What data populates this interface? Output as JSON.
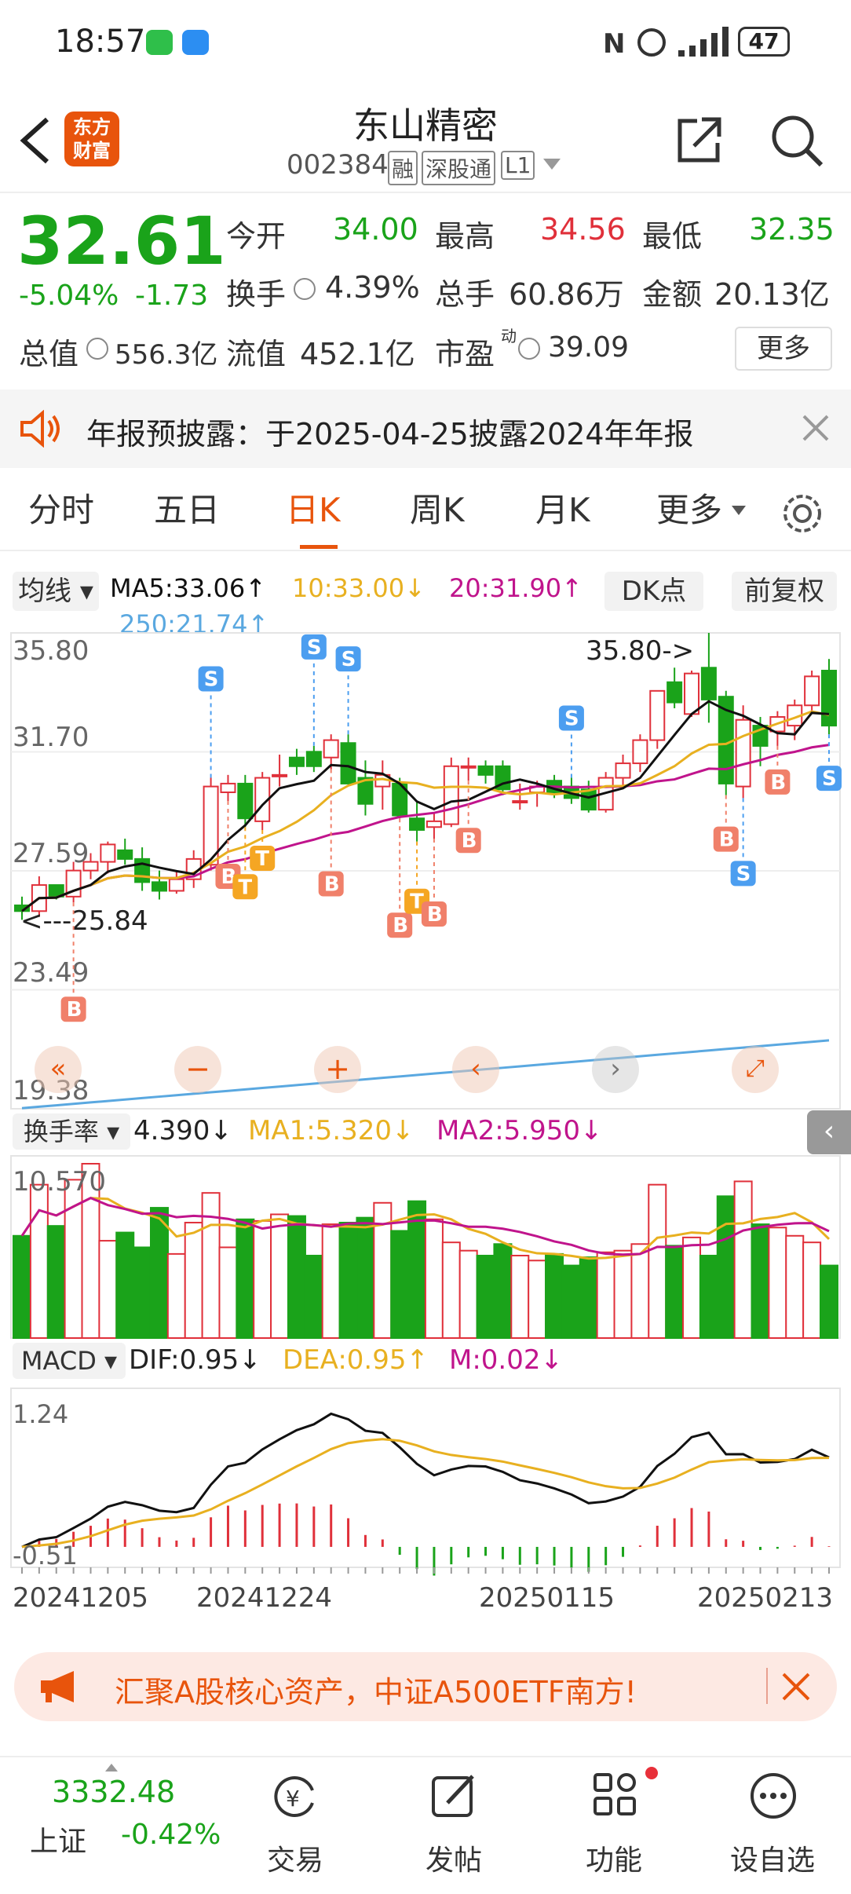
{
  "status": {
    "time": "18:57",
    "battery": "47"
  },
  "header": {
    "logo": "东方\n财富",
    "title": "东山精密",
    "code": "002384",
    "tags": [
      "融",
      "深股通",
      "L1"
    ]
  },
  "quote": {
    "price": "32.61",
    "pct": "-5.04%",
    "chg": "-1.73",
    "open_l": "今开",
    "open": "34.00",
    "high_l": "最高",
    "high": "34.56",
    "low_l": "最低",
    "low": "32.35",
    "turn_l": "换手",
    "turn": "4.39%",
    "vol_l": "总手",
    "vol": "60.86万",
    "amt_l": "金额",
    "amt": "20.13亿",
    "mcap_l": "总值",
    "mcap": "556.3亿",
    "fcap_l": "流值",
    "fcap": "452.1亿",
    "pe_l": "市盈",
    "pe_sup": "动",
    "pe": "39.09",
    "more": "更多"
  },
  "notice": {
    "text": "年报预披露：于2025-04-25披露2024年年报"
  },
  "tabs": [
    {
      "label": "分时"
    },
    {
      "label": "五日"
    },
    {
      "label": "日K"
    },
    {
      "label": "周K"
    },
    {
      "label": "月K"
    },
    {
      "label": "更多"
    }
  ],
  "ma": {
    "selector": "均线",
    "ma5": "MA5:33.06↑",
    "ma10": "10:33.00↓",
    "ma20": "20:31.90↑",
    "ma250": "250:21.74↑",
    "dk": "DK点",
    "fq": "前复权"
  },
  "kchart": {
    "y_labels": [
      "35.80",
      "31.70",
      "27.59",
      "23.49",
      "19.38"
    ],
    "max_label": "35.80->",
    "min_label": "<---25.84"
  },
  "turnover": {
    "selector": "换手率",
    "value": "4.390↓",
    "ma1": "MA1:5.320↓",
    "ma2": "MA2:5.950↓",
    "y_label": "10.570"
  },
  "macd": {
    "selector": "MACD",
    "dif": "DIF:0.95↓",
    "dea": "DEA:0.95↑",
    "m": "M:0.02↓",
    "y_top": "1.24",
    "y_bot": "-0.51"
  },
  "dates": [
    "20241205",
    "20241224",
    "20250115",
    "20250213"
  ],
  "banner": {
    "text": "汇聚A股核心资产，中证A500ETF南方!"
  },
  "bottom": {
    "index_val": "3332.48",
    "index_name": "上证",
    "index_pct": "-0.42%",
    "items": [
      {
        "label": "交易"
      },
      {
        "label": "发帖"
      },
      {
        "label": "功能"
      },
      {
        "label": "设自选"
      }
    ]
  },
  "colors": {
    "up": "#e0303a",
    "down": "#1aa31a",
    "ma5": "#111111",
    "ma10": "#e8b020",
    "ma20": "#c0148c",
    "ma250": "#5aa8e0",
    "accent": "#e8540c"
  },
  "chart_data": {
    "type": "candlestick",
    "candles": [
      [
        26.4,
        26.7,
        25.9,
        26.2
      ],
      [
        26.2,
        27.4,
        26.0,
        27.1
      ],
      [
        27.1,
        27.0,
        26.6,
        26.7
      ],
      [
        26.7,
        27.9,
        26.5,
        27.6
      ],
      [
        27.6,
        28.2,
        27.3,
        27.9
      ],
      [
        27.9,
        28.6,
        27.5,
        28.5
      ],
      [
        28.3,
        28.7,
        27.8,
        28.0
      ],
      [
        28.0,
        28.4,
        26.9,
        27.2
      ],
      [
        27.2,
        27.6,
        26.6,
        26.9
      ],
      [
        26.9,
        27.6,
        26.8,
        27.3
      ],
      [
        27.3,
        28.3,
        27.0,
        28.0
      ],
      [
        27.8,
        30.8,
        27.6,
        30.5
      ],
      [
        30.3,
        30.9,
        30.0,
        30.6
      ],
      [
        30.6,
        30.9,
        29.1,
        29.4
      ],
      [
        29.3,
        31.0,
        29.0,
        30.8
      ],
      [
        30.9,
        31.6,
        30.5,
        30.9
      ],
      [
        31.5,
        31.8,
        30.9,
        31.2
      ],
      [
        31.7,
        31.9,
        31.0,
        31.2
      ],
      [
        31.5,
        32.3,
        31.1,
        32.1
      ],
      [
        32.0,
        32.3,
        30.6,
        30.6
      ],
      [
        30.8,
        31.4,
        29.5,
        29.9
      ],
      [
        30.5,
        31.4,
        29.7,
        30.9
      ],
      [
        30.6,
        30.8,
        29.4,
        29.5
      ],
      [
        29.4,
        30.0,
        28.6,
        29.0
      ],
      [
        29.1,
        29.6,
        28.7,
        29.3
      ],
      [
        29.2,
        31.5,
        29.1,
        31.2
      ],
      [
        31.2,
        31.5,
        30.7,
        31.2
      ],
      [
        31.2,
        31.4,
        30.6,
        30.9
      ],
      [
        31.2,
        31.4,
        30.2,
        30.4
      ],
      [
        30.0,
        30.6,
        29.7,
        30.0
      ],
      [
        30.3,
        30.7,
        29.8,
        30.5
      ],
      [
        30.7,
        30.9,
        30.1,
        30.3
      ],
      [
        30.5,
        30.8,
        29.9,
        30.1
      ],
      [
        30.4,
        30.7,
        29.6,
        29.7
      ],
      [
        29.7,
        31.0,
        29.6,
        30.8
      ],
      [
        30.8,
        31.6,
        30.5,
        31.3
      ],
      [
        31.3,
        32.3,
        31.0,
        32.1
      ],
      [
        32.1,
        33.8,
        31.8,
        33.8
      ],
      [
        34.1,
        34.6,
        33.2,
        33.4
      ],
      [
        33.0,
        34.5,
        32.9,
        34.4
      ],
      [
        34.6,
        35.8,
        32.7,
        33.5
      ],
      [
        33.6,
        33.8,
        30.2,
        30.6
      ],
      [
        30.5,
        33.3,
        30.1,
        32.8
      ],
      [
        32.6,
        32.9,
        31.2,
        31.9
      ],
      [
        32.4,
        33.1,
        31.9,
        32.9
      ],
      [
        32.6,
        33.5,
        32.1,
        33.3
      ],
      [
        33.3,
        34.5,
        33.0,
        34.3
      ],
      [
        34.5,
        34.9,
        32.3,
        32.6
      ]
    ],
    "ylim": [
      19.38,
      35.8
    ],
    "max_label": "35.80",
    "min_label": "25.84",
    "turnover_ylim": [
      0,
      10.57
    ],
    "macd_ylim": [
      -0.51,
      1.24
    ],
    "dates": [
      "20241205",
      "20241224",
      "20250115",
      "20250213"
    ]
  }
}
